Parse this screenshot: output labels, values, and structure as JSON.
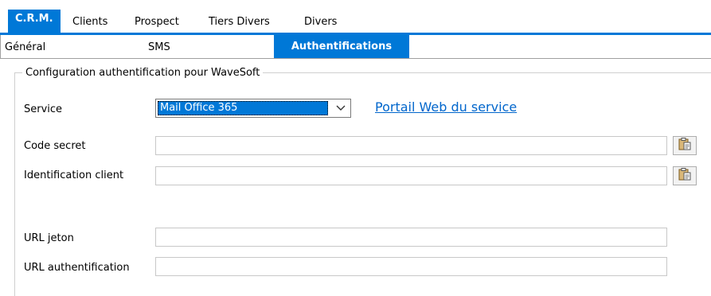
{
  "tabs_top": [
    {
      "label": "C.R.M.",
      "active": true
    },
    {
      "label": "Clients",
      "active": false
    },
    {
      "label": "Prospect",
      "active": false
    },
    {
      "label": "Tiers Divers",
      "active": false
    },
    {
      "label": "Divers",
      "active": false
    }
  ],
  "tabs_sub": [
    {
      "label": "Général",
      "active": false
    },
    {
      "label": "SMS",
      "active": false
    },
    {
      "label": "Authentifications",
      "active": true
    }
  ],
  "group": {
    "title": "Configuration authentification pour WaveSoft"
  },
  "service": {
    "label": "Service",
    "value": "Mail Office 365",
    "link": "Portail Web du service"
  },
  "fields": {
    "code_secret": {
      "label": "Code secret",
      "value": ""
    },
    "identification_client": {
      "label": "Identification client",
      "value": ""
    },
    "url_jeton": {
      "label": "URL jeton",
      "value": ""
    },
    "url_authentification": {
      "label": "URL authentification",
      "value": ""
    }
  },
  "colors": {
    "accent": "#0078d7",
    "link": "#0066cc"
  },
  "icons": {
    "paste": "paste-clipboard-icon",
    "dropdown": "chevron-down-icon"
  }
}
